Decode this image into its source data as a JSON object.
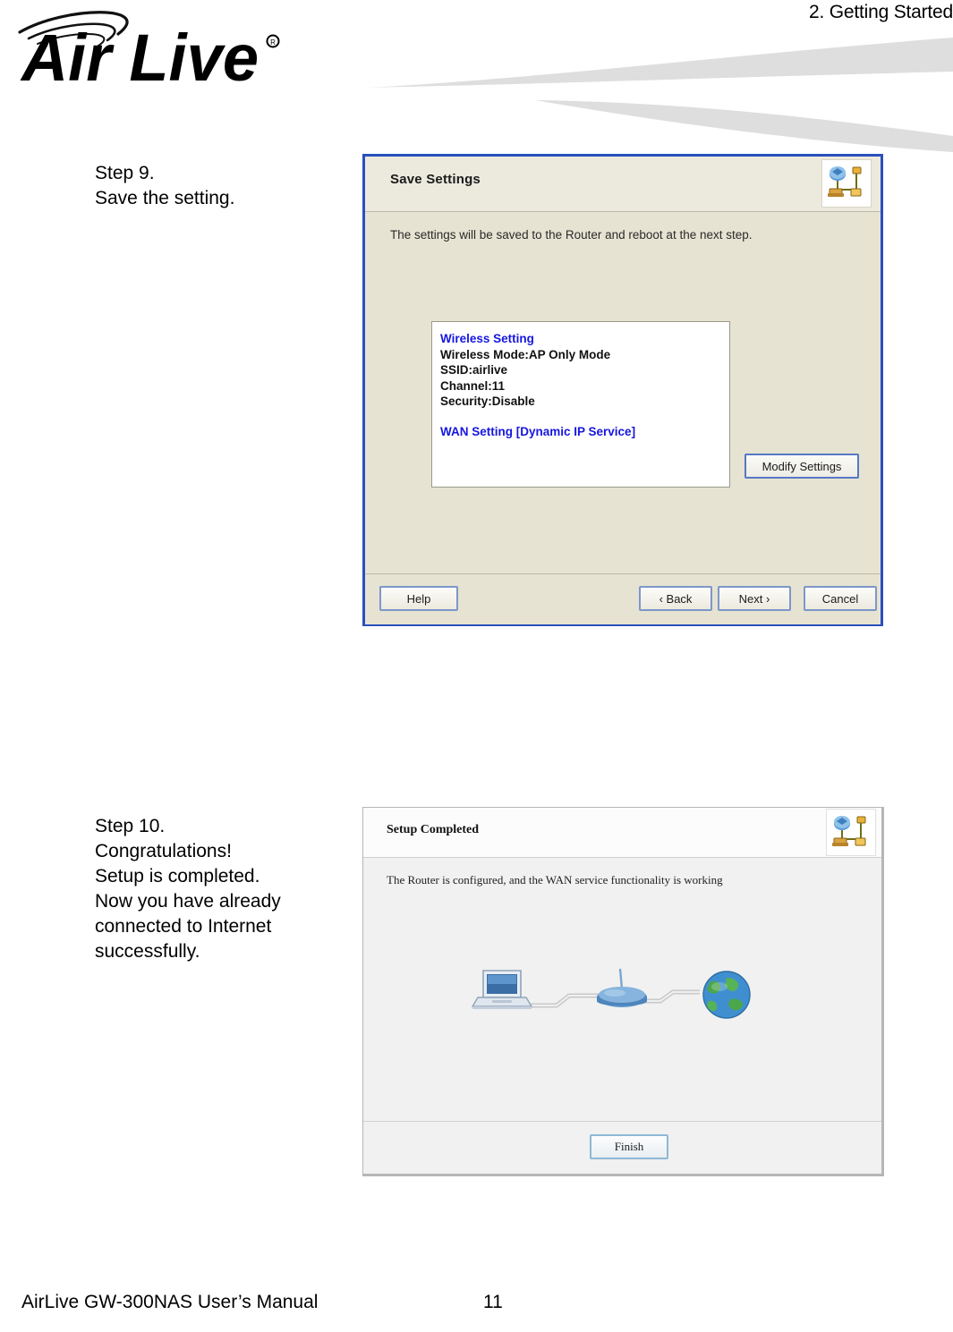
{
  "header": {
    "chapter_title": "2. Getting Started",
    "logo_text": "Air Live",
    "logo_registered_mark": "®",
    "logo_icon": "wireless-arcs-icon"
  },
  "steps": [
    {
      "id": "step9",
      "lines": [
        "Step 9.",
        "Save the setting."
      ]
    },
    {
      "id": "step10",
      "lines": [
        "Step 10.",
        "Congratulations!",
        "Setup is completed.",
        "Now you have already",
        "connected to Internet",
        "successfully."
      ]
    }
  ],
  "dialog_save_settings": {
    "title": "Save Settings",
    "header_icon": "network-setup-icon",
    "description": "The settings will be saved to the Router and reboot at the next step.",
    "summary": {
      "wireless_heading": "Wireless Setting",
      "wireless_mode": "Wireless Mode:AP Only Mode",
      "ssid": "SSID:airlive",
      "channel": "Channel:11",
      "security": "Security:Disable",
      "wan_heading": "WAN Setting  [Dynamic IP Service]"
    },
    "modify_button": "Modify Settings",
    "footer_buttons": {
      "help": "Help",
      "back": "‹ Back",
      "next": "Next ›",
      "cancel": "Cancel"
    },
    "colors": {
      "border": "#2a4fbf",
      "background": "#e6e3d2",
      "heading_text": "#1616e0"
    }
  },
  "dialog_setup_completed": {
    "title": "Setup Completed",
    "header_icon": "network-setup-icon",
    "description": "The Router is configured, and the WAN service functionality is working",
    "diagram": {
      "nodes": [
        "laptop-icon",
        "router-icon",
        "globe-icon"
      ],
      "connectors": [
        "cable-link",
        "cable-link"
      ]
    },
    "finish_button": "Finish",
    "colors": {
      "border": "#b6b6b6",
      "background": "#f1f1f1"
    }
  },
  "footer": {
    "manual_title": "AirLive GW-300NAS User’s Manual",
    "page_number": "11"
  }
}
